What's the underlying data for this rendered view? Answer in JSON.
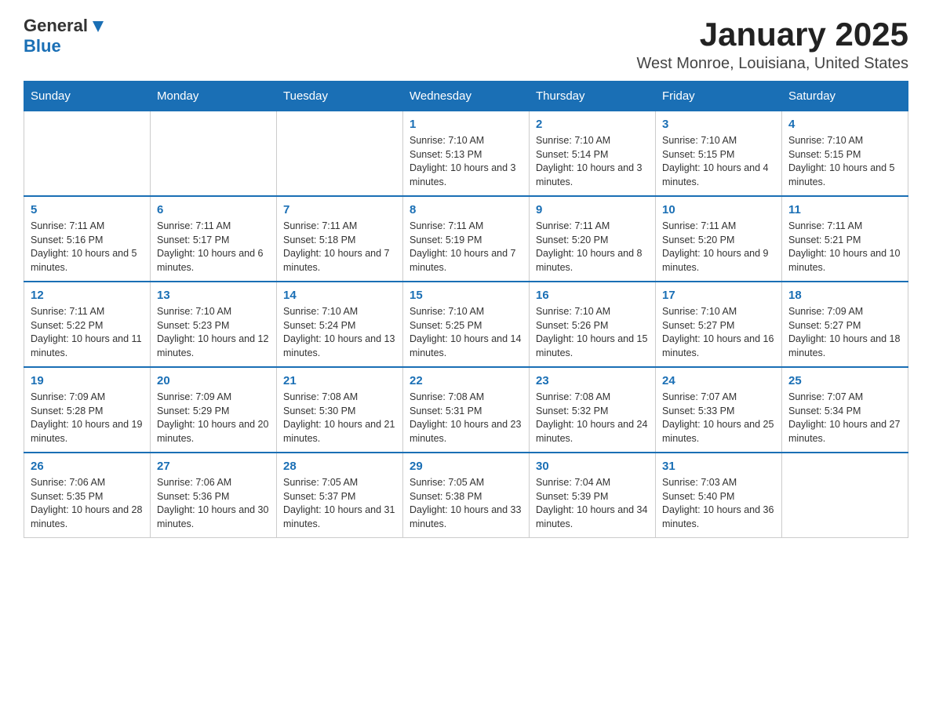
{
  "logo": {
    "general": "General",
    "blue": "Blue"
  },
  "header": {
    "title": "January 2025",
    "subtitle": "West Monroe, Louisiana, United States"
  },
  "days_of_week": [
    "Sunday",
    "Monday",
    "Tuesday",
    "Wednesday",
    "Thursday",
    "Friday",
    "Saturday"
  ],
  "weeks": [
    [
      {
        "day": "",
        "info": ""
      },
      {
        "day": "",
        "info": ""
      },
      {
        "day": "",
        "info": ""
      },
      {
        "day": "1",
        "info": "Sunrise: 7:10 AM\nSunset: 5:13 PM\nDaylight: 10 hours and 3 minutes."
      },
      {
        "day": "2",
        "info": "Sunrise: 7:10 AM\nSunset: 5:14 PM\nDaylight: 10 hours and 3 minutes."
      },
      {
        "day": "3",
        "info": "Sunrise: 7:10 AM\nSunset: 5:15 PM\nDaylight: 10 hours and 4 minutes."
      },
      {
        "day": "4",
        "info": "Sunrise: 7:10 AM\nSunset: 5:15 PM\nDaylight: 10 hours and 5 minutes."
      }
    ],
    [
      {
        "day": "5",
        "info": "Sunrise: 7:11 AM\nSunset: 5:16 PM\nDaylight: 10 hours and 5 minutes."
      },
      {
        "day": "6",
        "info": "Sunrise: 7:11 AM\nSunset: 5:17 PM\nDaylight: 10 hours and 6 minutes."
      },
      {
        "day": "7",
        "info": "Sunrise: 7:11 AM\nSunset: 5:18 PM\nDaylight: 10 hours and 7 minutes."
      },
      {
        "day": "8",
        "info": "Sunrise: 7:11 AM\nSunset: 5:19 PM\nDaylight: 10 hours and 7 minutes."
      },
      {
        "day": "9",
        "info": "Sunrise: 7:11 AM\nSunset: 5:20 PM\nDaylight: 10 hours and 8 minutes."
      },
      {
        "day": "10",
        "info": "Sunrise: 7:11 AM\nSunset: 5:20 PM\nDaylight: 10 hours and 9 minutes."
      },
      {
        "day": "11",
        "info": "Sunrise: 7:11 AM\nSunset: 5:21 PM\nDaylight: 10 hours and 10 minutes."
      }
    ],
    [
      {
        "day": "12",
        "info": "Sunrise: 7:11 AM\nSunset: 5:22 PM\nDaylight: 10 hours and 11 minutes."
      },
      {
        "day": "13",
        "info": "Sunrise: 7:10 AM\nSunset: 5:23 PM\nDaylight: 10 hours and 12 minutes."
      },
      {
        "day": "14",
        "info": "Sunrise: 7:10 AM\nSunset: 5:24 PM\nDaylight: 10 hours and 13 minutes."
      },
      {
        "day": "15",
        "info": "Sunrise: 7:10 AM\nSunset: 5:25 PM\nDaylight: 10 hours and 14 minutes."
      },
      {
        "day": "16",
        "info": "Sunrise: 7:10 AM\nSunset: 5:26 PM\nDaylight: 10 hours and 15 minutes."
      },
      {
        "day": "17",
        "info": "Sunrise: 7:10 AM\nSunset: 5:27 PM\nDaylight: 10 hours and 16 minutes."
      },
      {
        "day": "18",
        "info": "Sunrise: 7:09 AM\nSunset: 5:27 PM\nDaylight: 10 hours and 18 minutes."
      }
    ],
    [
      {
        "day": "19",
        "info": "Sunrise: 7:09 AM\nSunset: 5:28 PM\nDaylight: 10 hours and 19 minutes."
      },
      {
        "day": "20",
        "info": "Sunrise: 7:09 AM\nSunset: 5:29 PM\nDaylight: 10 hours and 20 minutes."
      },
      {
        "day": "21",
        "info": "Sunrise: 7:08 AM\nSunset: 5:30 PM\nDaylight: 10 hours and 21 minutes."
      },
      {
        "day": "22",
        "info": "Sunrise: 7:08 AM\nSunset: 5:31 PM\nDaylight: 10 hours and 23 minutes."
      },
      {
        "day": "23",
        "info": "Sunrise: 7:08 AM\nSunset: 5:32 PM\nDaylight: 10 hours and 24 minutes."
      },
      {
        "day": "24",
        "info": "Sunrise: 7:07 AM\nSunset: 5:33 PM\nDaylight: 10 hours and 25 minutes."
      },
      {
        "day": "25",
        "info": "Sunrise: 7:07 AM\nSunset: 5:34 PM\nDaylight: 10 hours and 27 minutes."
      }
    ],
    [
      {
        "day": "26",
        "info": "Sunrise: 7:06 AM\nSunset: 5:35 PM\nDaylight: 10 hours and 28 minutes."
      },
      {
        "day": "27",
        "info": "Sunrise: 7:06 AM\nSunset: 5:36 PM\nDaylight: 10 hours and 30 minutes."
      },
      {
        "day": "28",
        "info": "Sunrise: 7:05 AM\nSunset: 5:37 PM\nDaylight: 10 hours and 31 minutes."
      },
      {
        "day": "29",
        "info": "Sunrise: 7:05 AM\nSunset: 5:38 PM\nDaylight: 10 hours and 33 minutes."
      },
      {
        "day": "30",
        "info": "Sunrise: 7:04 AM\nSunset: 5:39 PM\nDaylight: 10 hours and 34 minutes."
      },
      {
        "day": "31",
        "info": "Sunrise: 7:03 AM\nSunset: 5:40 PM\nDaylight: 10 hours and 36 minutes."
      },
      {
        "day": "",
        "info": ""
      }
    ]
  ]
}
